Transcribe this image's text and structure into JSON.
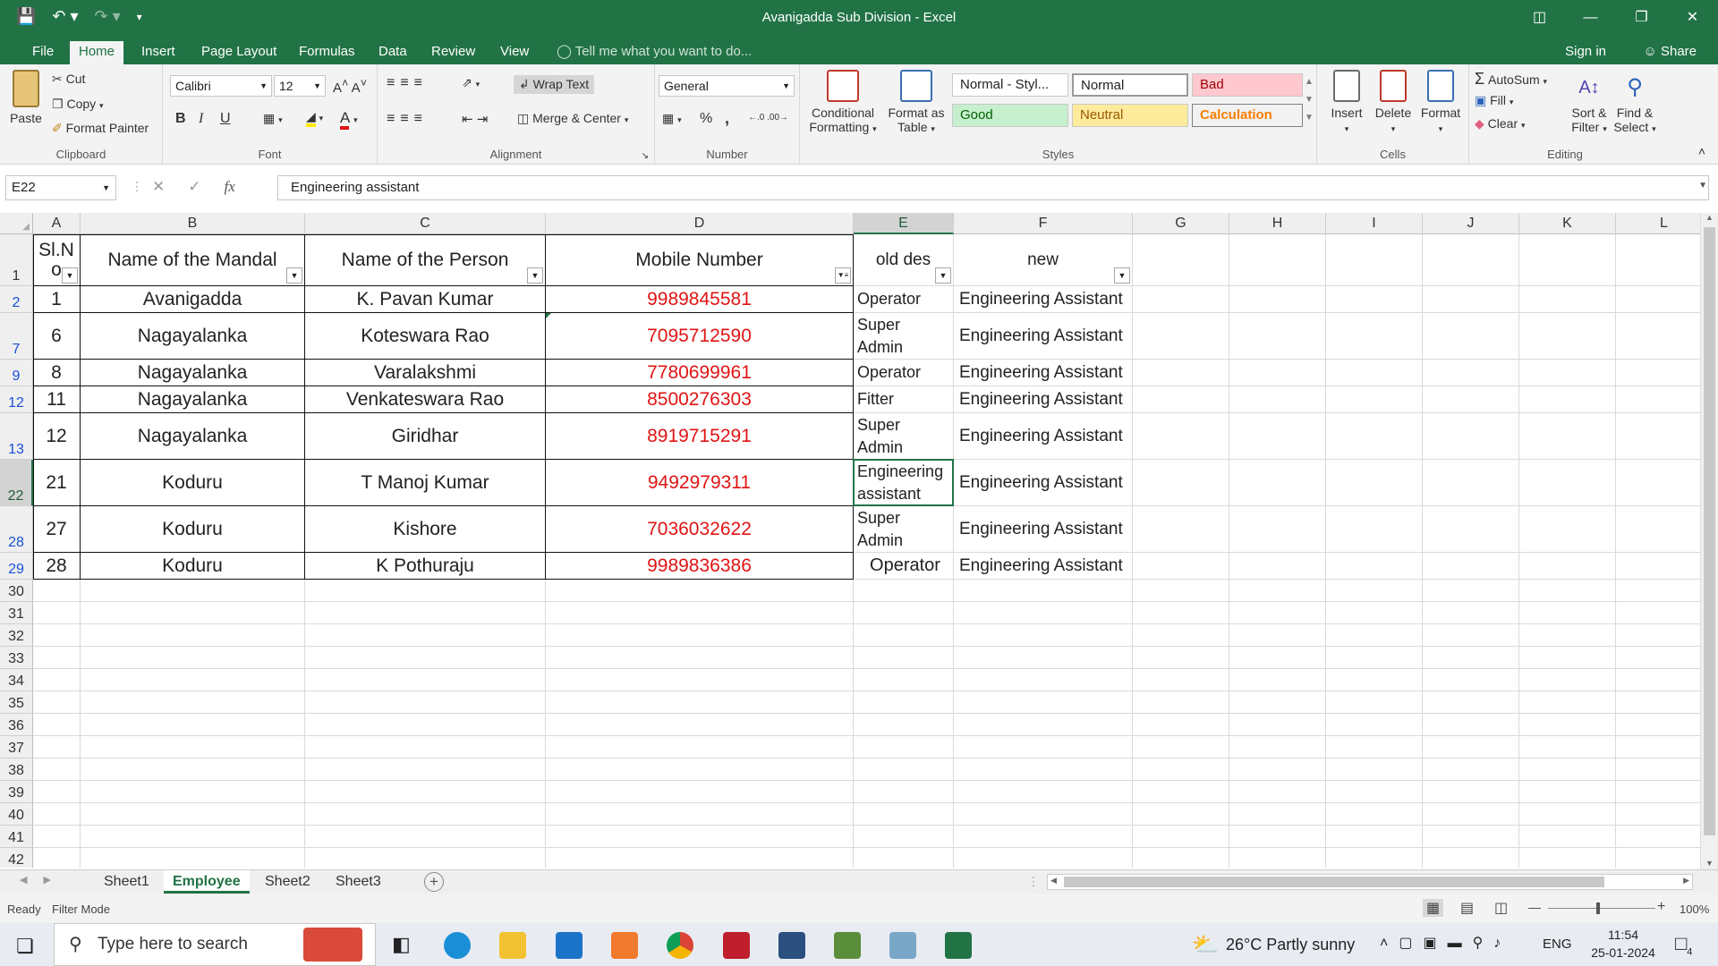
{
  "window": {
    "title": "Avanigadda Sub Division - Excel"
  },
  "menu": {
    "tabs": [
      "File",
      "Home",
      "Insert",
      "Page Layout",
      "Formulas",
      "Data",
      "Review",
      "View"
    ],
    "tell_me": "Tell me what you want to do...",
    "sign_in": "Sign in",
    "share": "Share"
  },
  "ribbon": {
    "clipboard": {
      "label": "Clipboard",
      "paste": "Paste",
      "cut": "Cut",
      "copy": "Copy",
      "format_painter": "Format Painter"
    },
    "font": {
      "label": "Font",
      "name": "Calibri",
      "size": "12",
      "bold": "B",
      "italic": "I",
      "underline": "U"
    },
    "alignment": {
      "label": "Alignment",
      "wrap_text": "Wrap Text",
      "merge_center": "Merge & Center"
    },
    "number": {
      "label": "Number",
      "format": "General",
      "percent": "%",
      "comma": ","
    },
    "styles": {
      "label": "Styles",
      "conditional_formatting_1": "Conditional",
      "conditional_formatting_2": "Formatting",
      "format_as_table_1": "Format as",
      "format_as_table_2": "Table",
      "normal_styl": "Normal - Styl...",
      "normal": "Normal",
      "bad": "Bad",
      "good": "Good",
      "neutral": "Neutral",
      "calculation": "Calculation"
    },
    "cells": {
      "label": "Cells",
      "insert": "Insert",
      "delete": "Delete",
      "format": "Format"
    },
    "editing": {
      "label": "Editing",
      "autosum": "AutoSum",
      "fill": "Fill",
      "clear": "Clear",
      "sort_filter_1": "Sort &",
      "sort_filter_2": "Filter",
      "find_select_1": "Find &",
      "find_select_2": "Select"
    }
  },
  "formula_bar": {
    "name_box": "E22",
    "fx": "fx",
    "value": "Engineering assistant"
  },
  "columns": [
    "A",
    "B",
    "C",
    "D",
    "E",
    "F",
    "G",
    "H",
    "I",
    "J",
    "K",
    "L"
  ],
  "header_row": {
    "row_number": "1",
    "a1": "Sl.N",
    "a2": "o",
    "b": "Name of the Mandal",
    "c": "Name of the Person",
    "d": "Mobile Number",
    "e": "old des",
    "f": "new"
  },
  "rows": [
    {
      "row": "2",
      "a": "1",
      "b": "Avanigadda",
      "c": "K. Pavan Kumar",
      "d": "9989845581",
      "e1": "Operator",
      "e2": "",
      "f": "Engineering Assistant"
    },
    {
      "row": "7",
      "a": "6",
      "b": "Nagayalanka",
      "c": "Koteswara Rao",
      "d": "7095712590",
      "e1": "Super",
      "e2": "Admin",
      "f": "Engineering Assistant"
    },
    {
      "row": "9",
      "a": "8",
      "b": "Nagayalanka",
      "c": "Varalakshmi",
      "d": "7780699961",
      "e1": "Operator",
      "e2": "",
      "f": "Engineering Assistant"
    },
    {
      "row": "12",
      "a": "11",
      "b": "Nagayalanka",
      "c": "Venkateswara Rao",
      "d": "8500276303",
      "e1": "Fitter",
      "e2": "",
      "f": "Engineering Assistant"
    },
    {
      "row": "13",
      "a": "12",
      "b": "Nagayalanka",
      "c": "Giridhar",
      "d": "8919715291",
      "e1": "Super",
      "e2": "Admin",
      "f": "Engineering Assistant"
    },
    {
      "row": "22",
      "a": "21",
      "b": "Koduru",
      "c": "T Manoj Kumar",
      "d": "9492979311",
      "e1": "Engineering",
      "e2": "assistant",
      "f": "Engineering Assistant"
    },
    {
      "row": "28",
      "a": "27",
      "b": "Koduru",
      "c": "Kishore",
      "d": "7036032622",
      "e1": "Super",
      "e2": "Admin",
      "f": "Engineering Assistant"
    },
    {
      "row": "29",
      "a": "28",
      "b": "Koduru",
      "c": "K Pothuraju",
      "d": "9989836386",
      "e1": "Operator",
      "e2": "",
      "f": "Engineering Assistant"
    }
  ],
  "empty_rows": [
    "30",
    "31",
    "32",
    "33",
    "34",
    "35",
    "36",
    "37",
    "38",
    "39",
    "40",
    "41",
    "42"
  ],
  "sheet_tabs": [
    "Sheet1",
    "Employee",
    "Sheet2",
    "Sheet3"
  ],
  "active_sheet": "Employee",
  "status": {
    "ready": "Ready",
    "mode": "Filter Mode",
    "zoom": "100%"
  },
  "taskbar": {
    "search_placeholder": "Type here to search",
    "weather": "26°C  Partly sunny",
    "language": "ENG",
    "time": "11:54",
    "date": "25-01-2024",
    "notifications": "4"
  },
  "colors": {
    "excel_green": "#217346",
    "mobile_red": "#e11414",
    "filtered_row_blue": "#1a4fd6"
  }
}
